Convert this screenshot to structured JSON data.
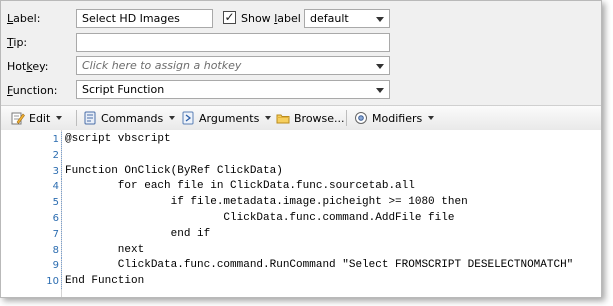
{
  "form": {
    "label_caption": "Label:",
    "label_value": "Select HD Images",
    "show_label_checked": true,
    "show_label_text": "Show label",
    "label_style": "default",
    "tip_caption": "Tip:",
    "tip_value": "",
    "hotkey_caption": "Hotkey:",
    "hotkey_placeholder": "Click here to assign a hotkey",
    "function_caption": "Function:",
    "function_value": "Script Function"
  },
  "toolbar": {
    "edit": "Edit",
    "commands": "Commands",
    "arguments": "Arguments",
    "browse": "Browse...",
    "modifiers": "Modifiers"
  },
  "editor": {
    "lines": [
      {
        "n": "1",
        "text": "@script vbscript"
      },
      {
        "n": "2",
        "text": ""
      },
      {
        "n": "3",
        "text": "Function OnClick(ByRef ClickData)"
      },
      {
        "n": "4",
        "text": "        for each file in ClickData.func.sourcetab.all"
      },
      {
        "n": "5",
        "text": "                if file.metadata.image.picheight >= 1080 then"
      },
      {
        "n": "6",
        "text": "                        ClickData.func.command.AddFile file"
      },
      {
        "n": "7",
        "text": "                end if"
      },
      {
        "n": "8",
        "text": "        next"
      },
      {
        "n": "9",
        "text": "        ClickData.func.command.RunCommand \"Select FROMSCRIPT DESELECTNOMATCH\""
      },
      {
        "n": "10",
        "text": "End Function"
      }
    ]
  },
  "colors": {
    "line_number": "#2b6cb0",
    "panel_bg": "#f0f0f0"
  }
}
